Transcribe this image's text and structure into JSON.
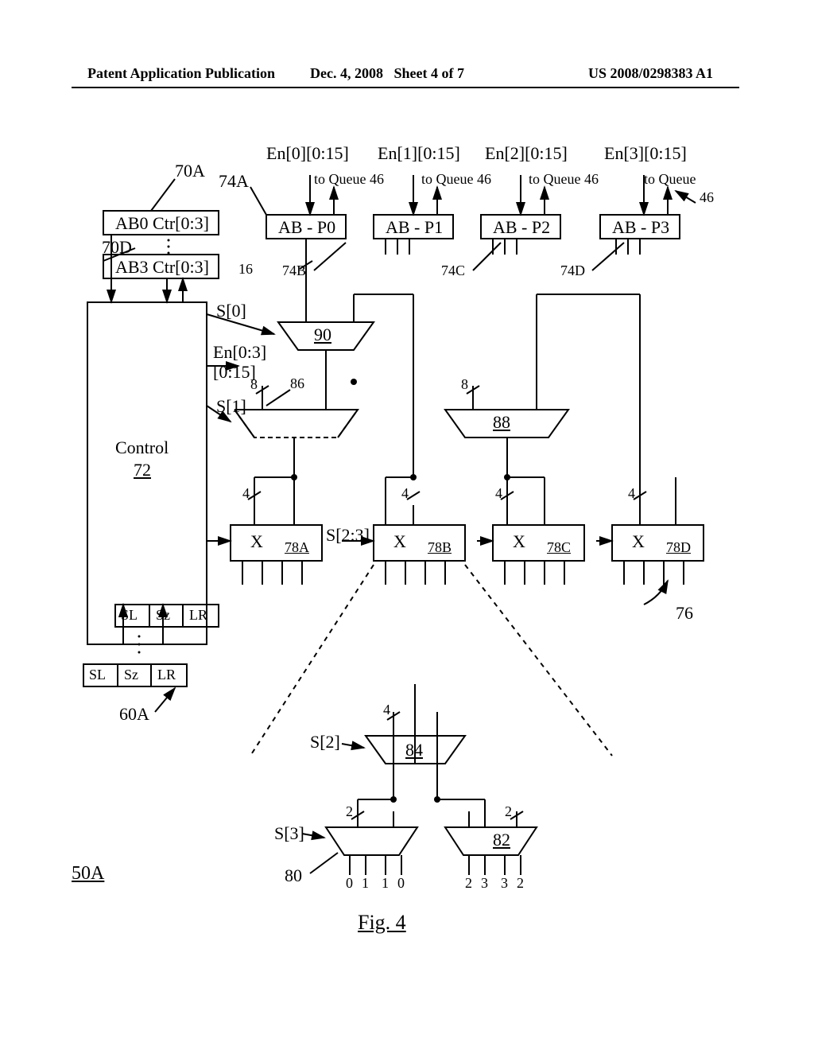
{
  "header": {
    "left": "Patent Application Publication",
    "mid_date": "Dec. 4, 2008",
    "mid_sheet": "Sheet 4 of 7",
    "right": "US 2008/0298383 A1"
  },
  "top_signals": {
    "en0": "En[0][0:15]",
    "en1": "En[1][0:15]",
    "en2": "En[2][0:15]",
    "en3": "En[3][0:15]",
    "to_queue": "to Queue 46",
    "to_queue_short": "to Queue",
    "q46": "46"
  },
  "refs": {
    "r70A": "70A",
    "r70D": "70D",
    "r74A": "74A",
    "r74B": "74B",
    "r74C": "74C",
    "r74D": "74D",
    "r90": "90",
    "r86": "86",
    "r88": "88",
    "r78A": "78A",
    "r78B": "78B",
    "r78C": "78C",
    "r78D": "78D",
    "r72": "72",
    "r76": "76",
    "r84": "84",
    "r82": "82",
    "r80": "80",
    "r60A": "60A",
    "r50A": "50A"
  },
  "labels": {
    "ab0ctr": "AB0 Ctr[0:3]",
    "ab3ctr": "AB3 Ctr[0:3]",
    "abp0": "AB - P0",
    "abp1": "AB - P1",
    "abp2": "AB - P2",
    "abp3": "AB - P3",
    "control": "Control",
    "s0": "S[0]",
    "s1": "S[1]",
    "s23": "S[2:3]",
    "s2": "S[2]",
    "s3": "S[3]",
    "en03_1": "En[0:3]",
    "en03_2": "[0:15]",
    "x": "X",
    "sl": "SL",
    "sz": "Sz",
    "lr": "LR",
    "w16": "16",
    "w8": "8",
    "w4": "4",
    "w2": "2",
    "d0": "0",
    "d1": "1",
    "d2": "2",
    "d3": "3"
  },
  "figure": "Fig. 4"
}
